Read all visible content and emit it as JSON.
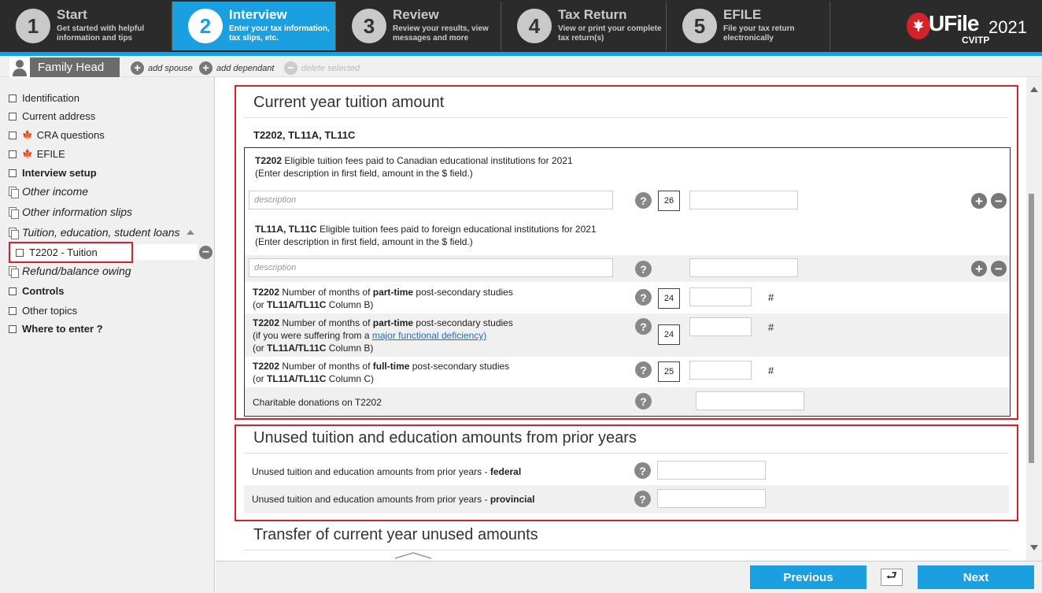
{
  "steps": [
    {
      "num": "1",
      "title": "Start",
      "sub1": "Get started with helpful",
      "sub2": "information and tips"
    },
    {
      "num": "2",
      "title": "Interview",
      "sub1": "Enter your tax information,",
      "sub2": "tax slips, etc."
    },
    {
      "num": "3",
      "title": "Review",
      "sub1": "Review your results, view",
      "sub2": "messages and more"
    },
    {
      "num": "4",
      "title": "Tax Return",
      "sub1": "View or print your complete",
      "sub2": "tax return(s)"
    },
    {
      "num": "5",
      "title": "EFILE",
      "sub1": "File your tax return",
      "sub2": "electronically"
    }
  ],
  "logo": {
    "brand": "UFile",
    "year": "2021",
    "sub": "CVITP"
  },
  "person_bar": {
    "tab": "Family Head",
    "add_spouse": "add spouse",
    "add_dependant": "add dependant",
    "delete_selected": "delete selected"
  },
  "sidebar": {
    "items": [
      {
        "label": "Identification"
      },
      {
        "label": "Current address"
      },
      {
        "label": "CRA questions"
      },
      {
        "label": "EFILE"
      },
      {
        "label": "Interview setup"
      },
      {
        "label": "Other income"
      },
      {
        "label": "Other information slips"
      },
      {
        "label": "Tuition, education, student loans"
      },
      {
        "label": "T2202 - Tuition"
      },
      {
        "label": "Refund/balance owing"
      },
      {
        "label": "Controls"
      },
      {
        "label": "Other topics"
      },
      {
        "label": "Where to enter ?"
      }
    ]
  },
  "section1": {
    "title": "Current year tuition amount",
    "subtitle": "T2202, TL11A, TL11C",
    "t2202_desc_b": "T2202",
    "t2202_desc": " Eligible tuition fees paid to Canadian educational institutions for 2021",
    "t2202_desc2": "(Enter description in first field, amount in the $ field.)",
    "placeholder": "description",
    "code_26": "26",
    "tl11_desc_b": "TL11A, TL11C",
    "tl11_desc": " Eligible tuition fees paid to foreign educational institutions for 2021",
    "tl11_desc2": "(Enter description in first field, amount in the $ field.)",
    "pt_b": "T2202",
    "pt_1": " Number of months of ",
    "pt_bold": "part-time",
    "pt_2": " post-secondary studies",
    "pt_3a": "(or ",
    "pt_3b": "TL11A/TL11C",
    "pt_3c": " Column B)",
    "code_24": "24",
    "pt2_b": "T2202",
    "pt2_1": " Number of months of ",
    "pt2_bold": "part-time",
    "pt2_2": " post-secondary studies",
    "pt2_3": "(if you were suffering from a ",
    "pt2_link": "major functional deficiency)",
    "pt2_4a": "(or ",
    "pt2_4b": "TL11A/TL11C",
    "pt2_4c": " Column B)",
    "code_24b": "24",
    "ft_b": "T2202",
    "ft_1": " Number of months of ",
    "ft_bold": "full-time",
    "ft_2": " post-secondary studies",
    "ft_3a": "(or ",
    "ft_3b": "TL11A/TL11C",
    "ft_3c": " Column C)",
    "code_25": "25",
    "hash": "#",
    "charitable": "Charitable donations on T2202"
  },
  "section2": {
    "title": "Unused tuition and education amounts from prior years",
    "federal_a": "Unused tuition and education amounts from prior years - ",
    "federal_b": "federal",
    "prov_a": "Unused tuition and education amounts from prior years - ",
    "prov_b": "provincial"
  },
  "section3": {
    "title": "Transfer of current year unused amounts"
  },
  "bottom": {
    "previous": "Previous",
    "back": "⮐",
    "next": "Next"
  }
}
